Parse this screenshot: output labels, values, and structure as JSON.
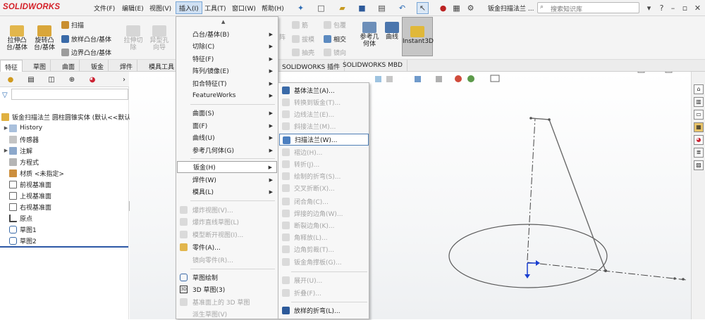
{
  "app": {
    "logo": "SOLIDWORKS",
    "doc_title": "钣金扫描法兰 ..."
  },
  "menubar": [
    "文件(F)",
    "编辑(E)",
    "视图(V)",
    "插入(I)",
    "工具(T)",
    "窗口(W)",
    "帮助(H)"
  ],
  "search": {
    "placeholder": "搜索知识库"
  },
  "commands": {
    "extrude": "拉伸凸\n台/基体",
    "revolve": "旋转凸\n台/基体",
    "sweep": "扫描",
    "loft": "放样凸台/基体",
    "boundary": "边界凸台/基体",
    "cut_extrude": "拉伸切\n除",
    "hole_wizard": "异型孔\n向导",
    "rib": "筋",
    "draft": "拔模",
    "shell": "抽壳",
    "wrap": "包覆",
    "intersect": "相交",
    "mirror": "镜向",
    "ref_geom": "参考几\n何体",
    "curves": "曲线",
    "instant3d": "Instant3D",
    "array_hint": "阵"
  },
  "tabs": [
    "特征",
    "草图",
    "曲面",
    "钣金",
    "焊件",
    "模具工具"
  ],
  "addin_tabs": [
    "SOLIDWORKS 插件",
    "SOLIDWORKS MBD"
  ],
  "tree": {
    "root": "钣金扫描法兰 圆柱圆锥实体 (默认<<默认",
    "items": [
      "History",
      "传感器",
      "注解",
      "方程式",
      "材质 <未指定>",
      "前视基准面",
      "上视基准面",
      "右视基准面",
      "原点",
      "草图1",
      "草图2"
    ]
  },
  "insert_menu": {
    "items": [
      {
        "label": "凸台/基体(B)",
        "sub": true
      },
      {
        "label": "切除(C)",
        "sub": true
      },
      {
        "label": "特征(F)",
        "sub": true
      },
      {
        "label": "阵列/镜像(E)",
        "sub": true
      },
      {
        "label": "扣合特征(T)",
        "sub": true
      },
      {
        "label": "FeatureWorks",
        "sub": true
      },
      {
        "label": "曲面(S)",
        "sub": true
      },
      {
        "label": "面(F)",
        "sub": true
      },
      {
        "label": "曲线(U)",
        "sub": true
      },
      {
        "label": "参考几何体(G)",
        "sub": true
      },
      {
        "label": "钣金(H)",
        "sub": true
      },
      {
        "label": "焊件(W)",
        "sub": true
      },
      {
        "label": "模具(L)",
        "sub": true
      },
      {
        "label": "爆炸视图(V)...",
        "sub": false
      },
      {
        "label": "爆炸直线草图(L)",
        "sub": false
      },
      {
        "label": "模型断开视图(I)...",
        "sub": false
      },
      {
        "label": "零件(A)...",
        "sub": false
      },
      {
        "label": "镜向零件(R)...",
        "sub": false
      },
      {
        "label": "草图绘制",
        "sub": false
      },
      {
        "label": "3D 草图(3)",
        "sub": false
      },
      {
        "label": "基准面上的 3D 草图",
        "sub": false
      },
      {
        "label": "派生草图(V)",
        "sub": false
      }
    ]
  },
  "sheetmetal_menu": {
    "items": [
      "基体法兰(A)...",
      "转换到钣金(T)...",
      "边线法兰(E)...",
      "斜接法兰(M)...",
      "扫描法兰(W)...",
      "褶边(H)...",
      "转折(J)...",
      "绘制的折弯(S)...",
      "交叉折断(X)...",
      "闭合角(C)...",
      "焊接的边角(W)...",
      "断裂边角(K)...",
      "角释放(L)...",
      "边角剪裁(T)...",
      "钣金角撑板(G)...",
      "展开(U)...",
      "折叠(F)...",
      "放样的折弯(L)..."
    ]
  },
  "colors": {
    "accent": "#2d6cb5",
    "highlight": "#cfe0f3",
    "logo_red": "#d42028"
  }
}
